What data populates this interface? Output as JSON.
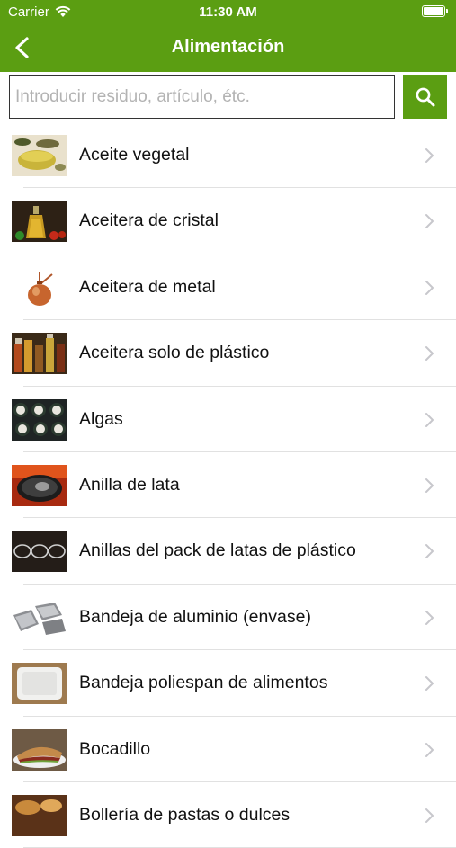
{
  "status": {
    "carrier": "Carrier",
    "time": "11:30 AM"
  },
  "nav": {
    "title": "Alimentación",
    "back_icon": "chevron-left-icon"
  },
  "search": {
    "placeholder": "Introducir residuo, artículo, étc.",
    "value": "",
    "button_icon": "search-icon"
  },
  "colors": {
    "brand_green": "#5b9e12",
    "chevron": "#c7c7cc",
    "separator": "#e1e1e1"
  },
  "items": [
    {
      "label": "Aceite vegetal",
      "thumb": "oil-bowl"
    },
    {
      "label": "Aceitera de cristal",
      "thumb": "glass-cruet"
    },
    {
      "label": "Aceitera de metal",
      "thumb": "copper-oilcan"
    },
    {
      "label": "Aceitera solo de plástico",
      "thumb": "plastic-bottles"
    },
    {
      "label": "Algas",
      "thumb": "sushi"
    },
    {
      "label": "Anilla de lata",
      "thumb": "can-ring"
    },
    {
      "label": "Anillas del pack de latas de plástico",
      "thumb": "six-pack-rings"
    },
    {
      "label": "Bandeja de aluminio (envase)",
      "thumb": "aluminium-trays"
    },
    {
      "label": "Bandeja poliespan de alimentos",
      "thumb": "foam-tray"
    },
    {
      "label": "Bocadillo",
      "thumb": "sandwich"
    },
    {
      "label": "Bollería de pastas o dulces",
      "thumb": "pastries"
    }
  ]
}
